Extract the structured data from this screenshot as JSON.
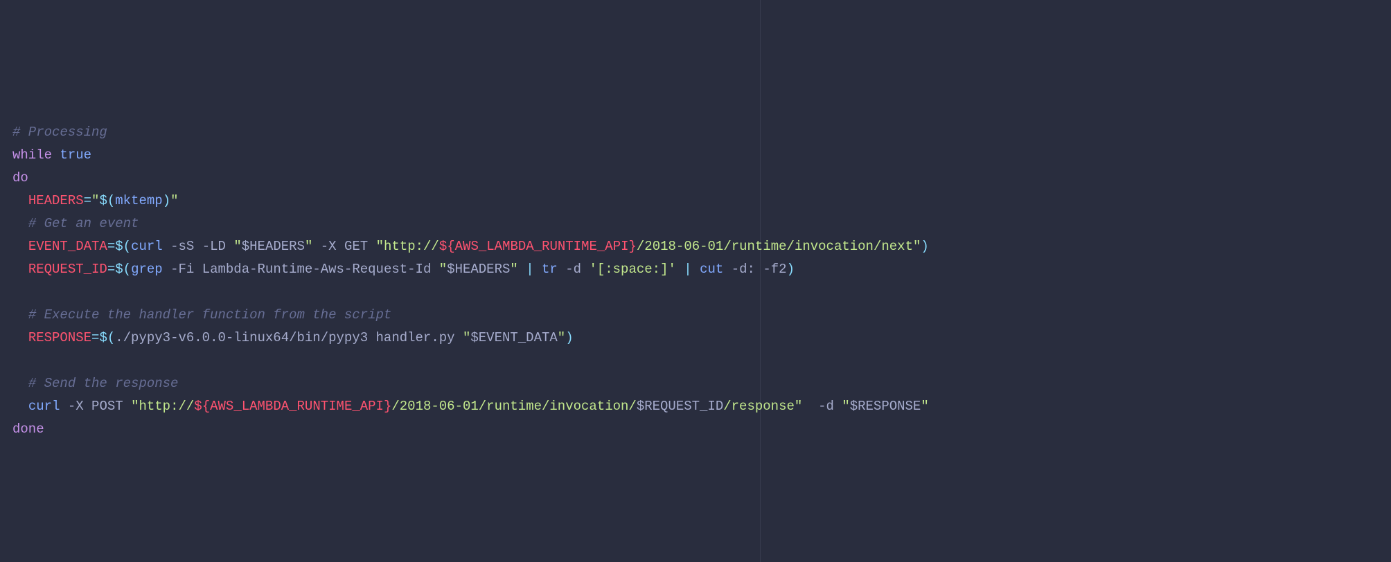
{
  "code": {
    "c1": "# Processing",
    "while": "while",
    "true": "true",
    "do": "do",
    "headers_var": "HEADERS",
    "eq": "=",
    "dq": "\"",
    "dollar_open": "$(",
    "close_paren": ")",
    "mktemp": "mktemp",
    "c2": "# Get an event",
    "event_data_var": "EVENT_DATA",
    "curl": "curl",
    "sS": "-sS",
    "LD": "-LD",
    "dollar_headers": "$HEADERS",
    "X": "-X",
    "GET": "GET",
    "http_pre": "http://",
    "interp_open": "${",
    "aws_api": "AWS_LAMBDA_RUNTIME_API",
    "interp_close": "}",
    "path_next": "/2018-06-01/runtime/invocation/next",
    "request_id_var": "REQUEST_ID",
    "grep": "grep",
    "Fi": "-Fi",
    "lambda_hdr": "Lambda-Runtime-Aws-Request-Id",
    "pipe": " | ",
    "tr": "tr",
    "d": "-d",
    "space_class": "'[:space:]'",
    "cut": "cut",
    "d_colon": "-d:",
    "f2": "-f2",
    "c3": "# Execute the handler function from the script",
    "response_var": "RESPONSE",
    "pypy_path": "./pypy3-v6.0.0-linux64/bin/pypy3",
    "handler": "handler.py",
    "dollar_event_data": "$EVENT_DATA",
    "c4": "# Send the response",
    "POST": "POST",
    "path_inv": "/2018-06-01/runtime/invocation/",
    "dollar_request_id": "$REQUEST_ID",
    "path_resp": "/response",
    "d_flag": "-d",
    "dollar_response": "$RESPONSE",
    "done": "done"
  }
}
